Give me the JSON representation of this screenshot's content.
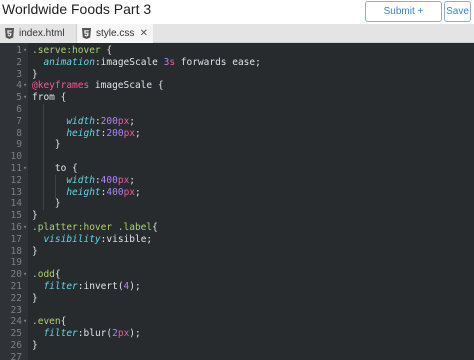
{
  "header": {
    "title": "Worldwide Foods Part 3",
    "submit_label": "Submit + Continue",
    "save_label": "Save"
  },
  "tabs": [
    {
      "label": "index.html",
      "icon": "html5-icon",
      "active": false
    },
    {
      "label": "style.css",
      "icon": "css3-icon",
      "active": true,
      "close": "✕"
    }
  ],
  "colors": {
    "editor_bg": "#282b2e",
    "selector": "#a8d36b",
    "property": "#61d6e6",
    "number": "#ae81ff",
    "unit": "#ef5b9c",
    "button_accent": "#3d7fd3"
  },
  "code_lines": [
    {
      "n": "1",
      "fold": "▾",
      "t": [
        {
          "c": "t-sel",
          "s": ".serve:hover"
        },
        {
          "c": "t-def",
          "s": " {"
        }
      ]
    },
    {
      "n": "2",
      "fold": "",
      "t": [
        {
          "c": "t-def",
          "s": "  "
        },
        {
          "c": "t-prop",
          "s": "animation"
        },
        {
          "c": "t-def",
          "s": ":imageScale "
        },
        {
          "c": "t-num",
          "s": "3"
        },
        {
          "c": "t-unit",
          "s": "s"
        },
        {
          "c": "t-def",
          "s": " forwards ease;"
        }
      ]
    },
    {
      "n": "3",
      "fold": "",
      "t": [
        {
          "c": "t-def",
          "s": "}"
        }
      ]
    },
    {
      "n": "4",
      "fold": "▾",
      "t": [
        {
          "c": "t-at",
          "s": "@keyframes"
        },
        {
          "c": "t-def",
          "s": " imageScale {"
        }
      ]
    },
    {
      "n": "5",
      "fold": "▾",
      "t": [
        {
          "c": "t-def",
          "s": "from {"
        }
      ]
    },
    {
      "n": "6",
      "fold": "",
      "t": []
    },
    {
      "n": "7",
      "fold": "",
      "t": [
        {
          "c": "t-def",
          "s": "      "
        },
        {
          "c": "t-prop",
          "s": "width"
        },
        {
          "c": "t-def",
          "s": ":"
        },
        {
          "c": "t-num",
          "s": "200"
        },
        {
          "c": "t-unit",
          "s": "px"
        },
        {
          "c": "t-def",
          "s": ";"
        }
      ]
    },
    {
      "n": "8",
      "fold": "",
      "t": [
        {
          "c": "t-def",
          "s": "      "
        },
        {
          "c": "t-prop",
          "s": "height"
        },
        {
          "c": "t-def",
          "s": ":"
        },
        {
          "c": "t-num",
          "s": "200"
        },
        {
          "c": "t-unit",
          "s": "px"
        },
        {
          "c": "t-def",
          "s": ";"
        }
      ]
    },
    {
      "n": "9",
      "fold": "",
      "t": [
        {
          "c": "t-def",
          "s": "    }"
        }
      ]
    },
    {
      "n": "10",
      "fold": "",
      "t": []
    },
    {
      "n": "11",
      "fold": "▾",
      "t": [
        {
          "c": "t-def",
          "s": "    to {"
        }
      ]
    },
    {
      "n": "12",
      "fold": "",
      "t": [
        {
          "c": "t-def",
          "s": "      "
        },
        {
          "c": "t-prop",
          "s": "width"
        },
        {
          "c": "t-def",
          "s": ":"
        },
        {
          "c": "t-num",
          "s": "400"
        },
        {
          "c": "t-unit",
          "s": "px"
        },
        {
          "c": "t-def",
          "s": ";"
        }
      ]
    },
    {
      "n": "13",
      "fold": "",
      "t": [
        {
          "c": "t-def",
          "s": "      "
        },
        {
          "c": "t-prop",
          "s": "height"
        },
        {
          "c": "t-def",
          "s": ":"
        },
        {
          "c": "t-num",
          "s": "400"
        },
        {
          "c": "t-unit",
          "s": "px"
        },
        {
          "c": "t-def",
          "s": ";"
        }
      ]
    },
    {
      "n": "14",
      "fold": "",
      "t": [
        {
          "c": "t-def",
          "s": "    }"
        }
      ]
    },
    {
      "n": "15",
      "fold": "",
      "t": [
        {
          "c": "t-def",
          "s": "}"
        }
      ]
    },
    {
      "n": "16",
      "fold": "▾",
      "t": [
        {
          "c": "t-sel",
          "s": ".platter:hover .label"
        },
        {
          "c": "t-def",
          "s": "{"
        }
      ]
    },
    {
      "n": "17",
      "fold": "",
      "t": [
        {
          "c": "t-def",
          "s": "  "
        },
        {
          "c": "t-prop",
          "s": "visibility"
        },
        {
          "c": "t-def",
          "s": ":visible;"
        }
      ]
    },
    {
      "n": "18",
      "fold": "",
      "t": [
        {
          "c": "t-def",
          "s": "}"
        }
      ]
    },
    {
      "n": "19",
      "fold": "",
      "t": []
    },
    {
      "n": "20",
      "fold": "▾",
      "t": [
        {
          "c": "t-sel",
          "s": ".odd"
        },
        {
          "c": "t-def",
          "s": "{"
        }
      ]
    },
    {
      "n": "21",
      "fold": "",
      "t": [
        {
          "c": "t-def",
          "s": "  "
        },
        {
          "c": "t-prop",
          "s": "filter"
        },
        {
          "c": "t-def",
          "s": ":invert("
        },
        {
          "c": "t-num",
          "s": "4"
        },
        {
          "c": "t-def",
          "s": ");"
        }
      ]
    },
    {
      "n": "22",
      "fold": "",
      "t": [
        {
          "c": "t-def",
          "s": "}"
        }
      ]
    },
    {
      "n": "23",
      "fold": "",
      "t": []
    },
    {
      "n": "24",
      "fold": "▾",
      "t": [
        {
          "c": "t-sel",
          "s": ".even"
        },
        {
          "c": "t-def",
          "s": "{"
        }
      ]
    },
    {
      "n": "25",
      "fold": "",
      "t": [
        {
          "c": "t-def",
          "s": "  "
        },
        {
          "c": "t-prop",
          "s": "filter"
        },
        {
          "c": "t-def",
          "s": ":blur("
        },
        {
          "c": "t-num",
          "s": "2"
        },
        {
          "c": "t-unit",
          "s": "px"
        },
        {
          "c": "t-def",
          "s": ");"
        }
      ]
    },
    {
      "n": "26",
      "fold": "",
      "t": [
        {
          "c": "t-def",
          "s": "}"
        }
      ]
    },
    {
      "n": "27",
      "fold": "",
      "t": []
    }
  ]
}
